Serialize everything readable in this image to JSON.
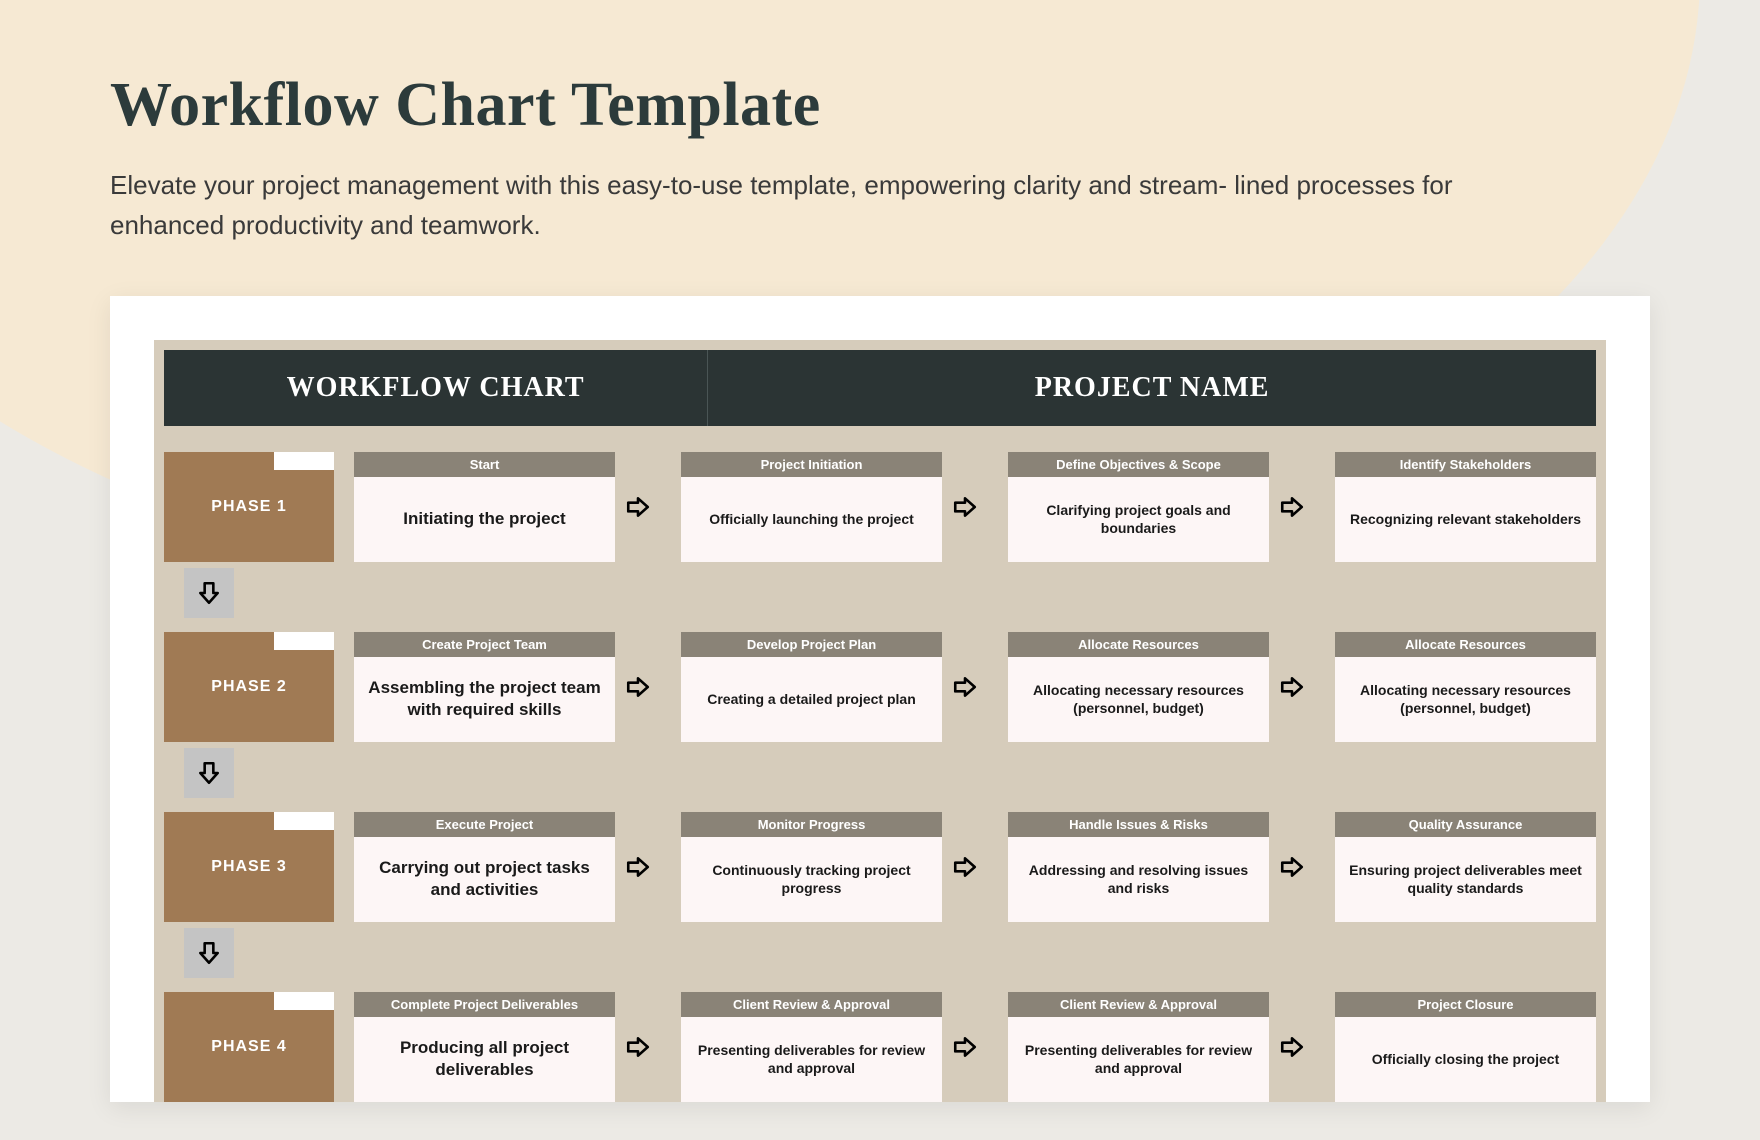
{
  "page": {
    "title": "Workflow Chart Template",
    "subtitle": "Elevate your project management with this easy-to-use template, empowering clarity and stream-\nlined processes for enhanced productivity and teamwork."
  },
  "header": {
    "left": "WORKFLOW CHART",
    "right": "PROJECT NAME"
  },
  "phases": [
    {
      "label": "PHASE 1",
      "steps": [
        {
          "title": "Start",
          "body": "Initiating the project"
        },
        {
          "title": "Project Initiation",
          "body": "Officially launching the project"
        },
        {
          "title": "Define Objectives & Scope",
          "body": "Clarifying project goals and boundaries"
        },
        {
          "title": "Identify Stakeholders",
          "body": "Recognizing relevant stakeholders"
        }
      ]
    },
    {
      "label": "PHASE 2",
      "steps": [
        {
          "title": "Create Project Team",
          "body": "Assembling the project team with required skills"
        },
        {
          "title": "Develop Project Plan",
          "body": "Creating a detailed project plan"
        },
        {
          "title": "Allocate Resources",
          "body": "Allocating necessary resources (personnel, budget)"
        },
        {
          "title": "Allocate Resources",
          "body": "Allocating necessary resources (personnel, budget)"
        }
      ]
    },
    {
      "label": "PHASE 3",
      "steps": [
        {
          "title": "Execute Project",
          "body": "Carrying out project tasks and activities"
        },
        {
          "title": "Monitor Progress",
          "body": "Continuously tracking project progress"
        },
        {
          "title": "Handle Issues & Risks",
          "body": "Addressing and resolving issues and risks"
        },
        {
          "title": "Quality Assurance",
          "body": "Ensuring project deliverables meet quality standards"
        }
      ]
    },
    {
      "label": "PHASE 4",
      "steps": [
        {
          "title": "Complete Project Deliverables",
          "body": "Producing all project deliverables"
        },
        {
          "title": "Client Review & Approval",
          "body": "Presenting deliverables for review and approval"
        },
        {
          "title": "Client Review & Approval",
          "body": "Presenting deliverables for review and approval"
        },
        {
          "title": "Project Closure",
          "body": "Officially closing the project"
        }
      ]
    }
  ]
}
